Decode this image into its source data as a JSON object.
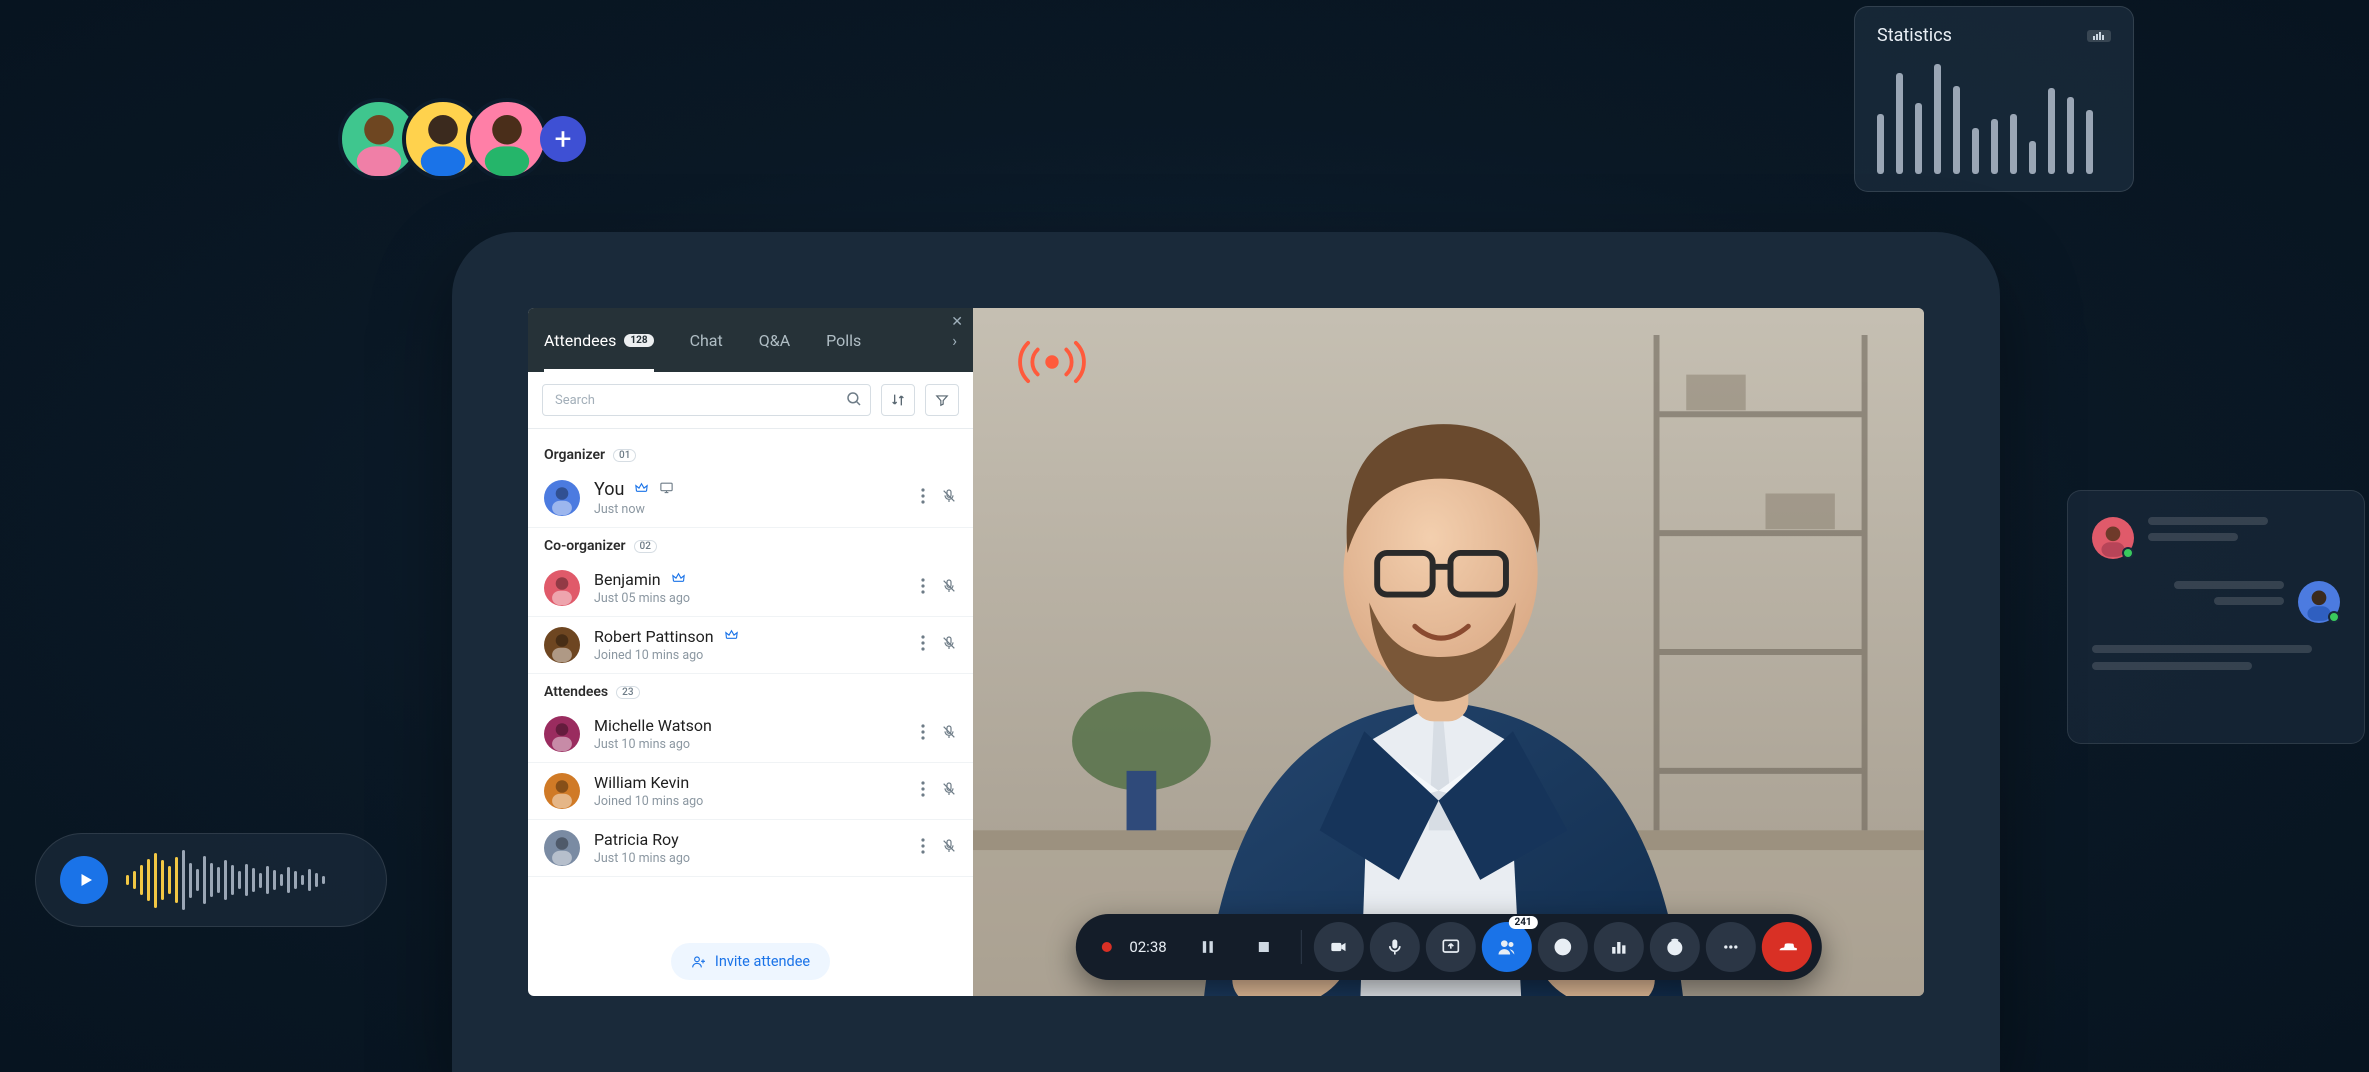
{
  "avatarStack": {
    "showPlus": true
  },
  "stats": {
    "title": "Statistics",
    "badgeIcon": "chart-icon",
    "bars": [
      55,
      92,
      65,
      100,
      80,
      42,
      50,
      55,
      30,
      78,
      70,
      58
    ]
  },
  "chatThread": {
    "rows": [
      {
        "side": "left",
        "lines": [
          120,
          90
        ]
      },
      {
        "side": "right",
        "lines": [
          110,
          70
        ]
      }
    ],
    "footerLines": [
      220,
      160
    ]
  },
  "audio": {
    "waveform": [
      10,
      18,
      30,
      42,
      55,
      40,
      28,
      46,
      60,
      35,
      22,
      48,
      34,
      26,
      40,
      30,
      18,
      32,
      24,
      15,
      28,
      20,
      12,
      26,
      18,
      10,
      22,
      14,
      8
    ]
  },
  "sidebar": {
    "tabs": [
      {
        "key": "attendees",
        "label": "Attendees",
        "count": "128",
        "active": true
      },
      {
        "key": "chat",
        "label": "Chat"
      },
      {
        "key": "qa",
        "label": "Q&A"
      },
      {
        "key": "polls",
        "label": "Polls"
      }
    ],
    "searchPlaceholder": "Search",
    "sections": [
      {
        "title": "Organizer",
        "count": "01",
        "rows": [
          {
            "name": "You",
            "sub": "Just now",
            "crown": true,
            "projector": true,
            "big": true
          }
        ]
      },
      {
        "title": "Co-organizer",
        "count": "02",
        "rows": [
          {
            "name": "Benjamin",
            "sub": "Just 05 mins ago",
            "crown": true
          },
          {
            "name": "Robert Pattinson",
            "sub": "Joined 10 mins ago",
            "crown": true
          }
        ]
      },
      {
        "title": "Attendees",
        "count": "23",
        "rows": [
          {
            "name": "Michelle Watson",
            "sub": "Just 10 mins ago"
          },
          {
            "name": "William Kevin",
            "sub": "Joined 10 mins ago"
          },
          {
            "name": "Patricia Roy",
            "sub": "Just 10 mins ago"
          }
        ]
      }
    ],
    "inviteLabel": "Invite attendee"
  },
  "controls": {
    "timer": "02:38",
    "participantsBadge": "241"
  },
  "avatarColors": [
    "#3FC68E",
    "#FFD24D",
    "#FF7FA7",
    "#3E50D4",
    "#4C7BE0",
    "#E05A6A",
    "#6E4621",
    "#9A2C5F",
    "#D07A26",
    "#7A8BA3",
    "#5F3F2D",
    "#8E5A3C"
  ]
}
